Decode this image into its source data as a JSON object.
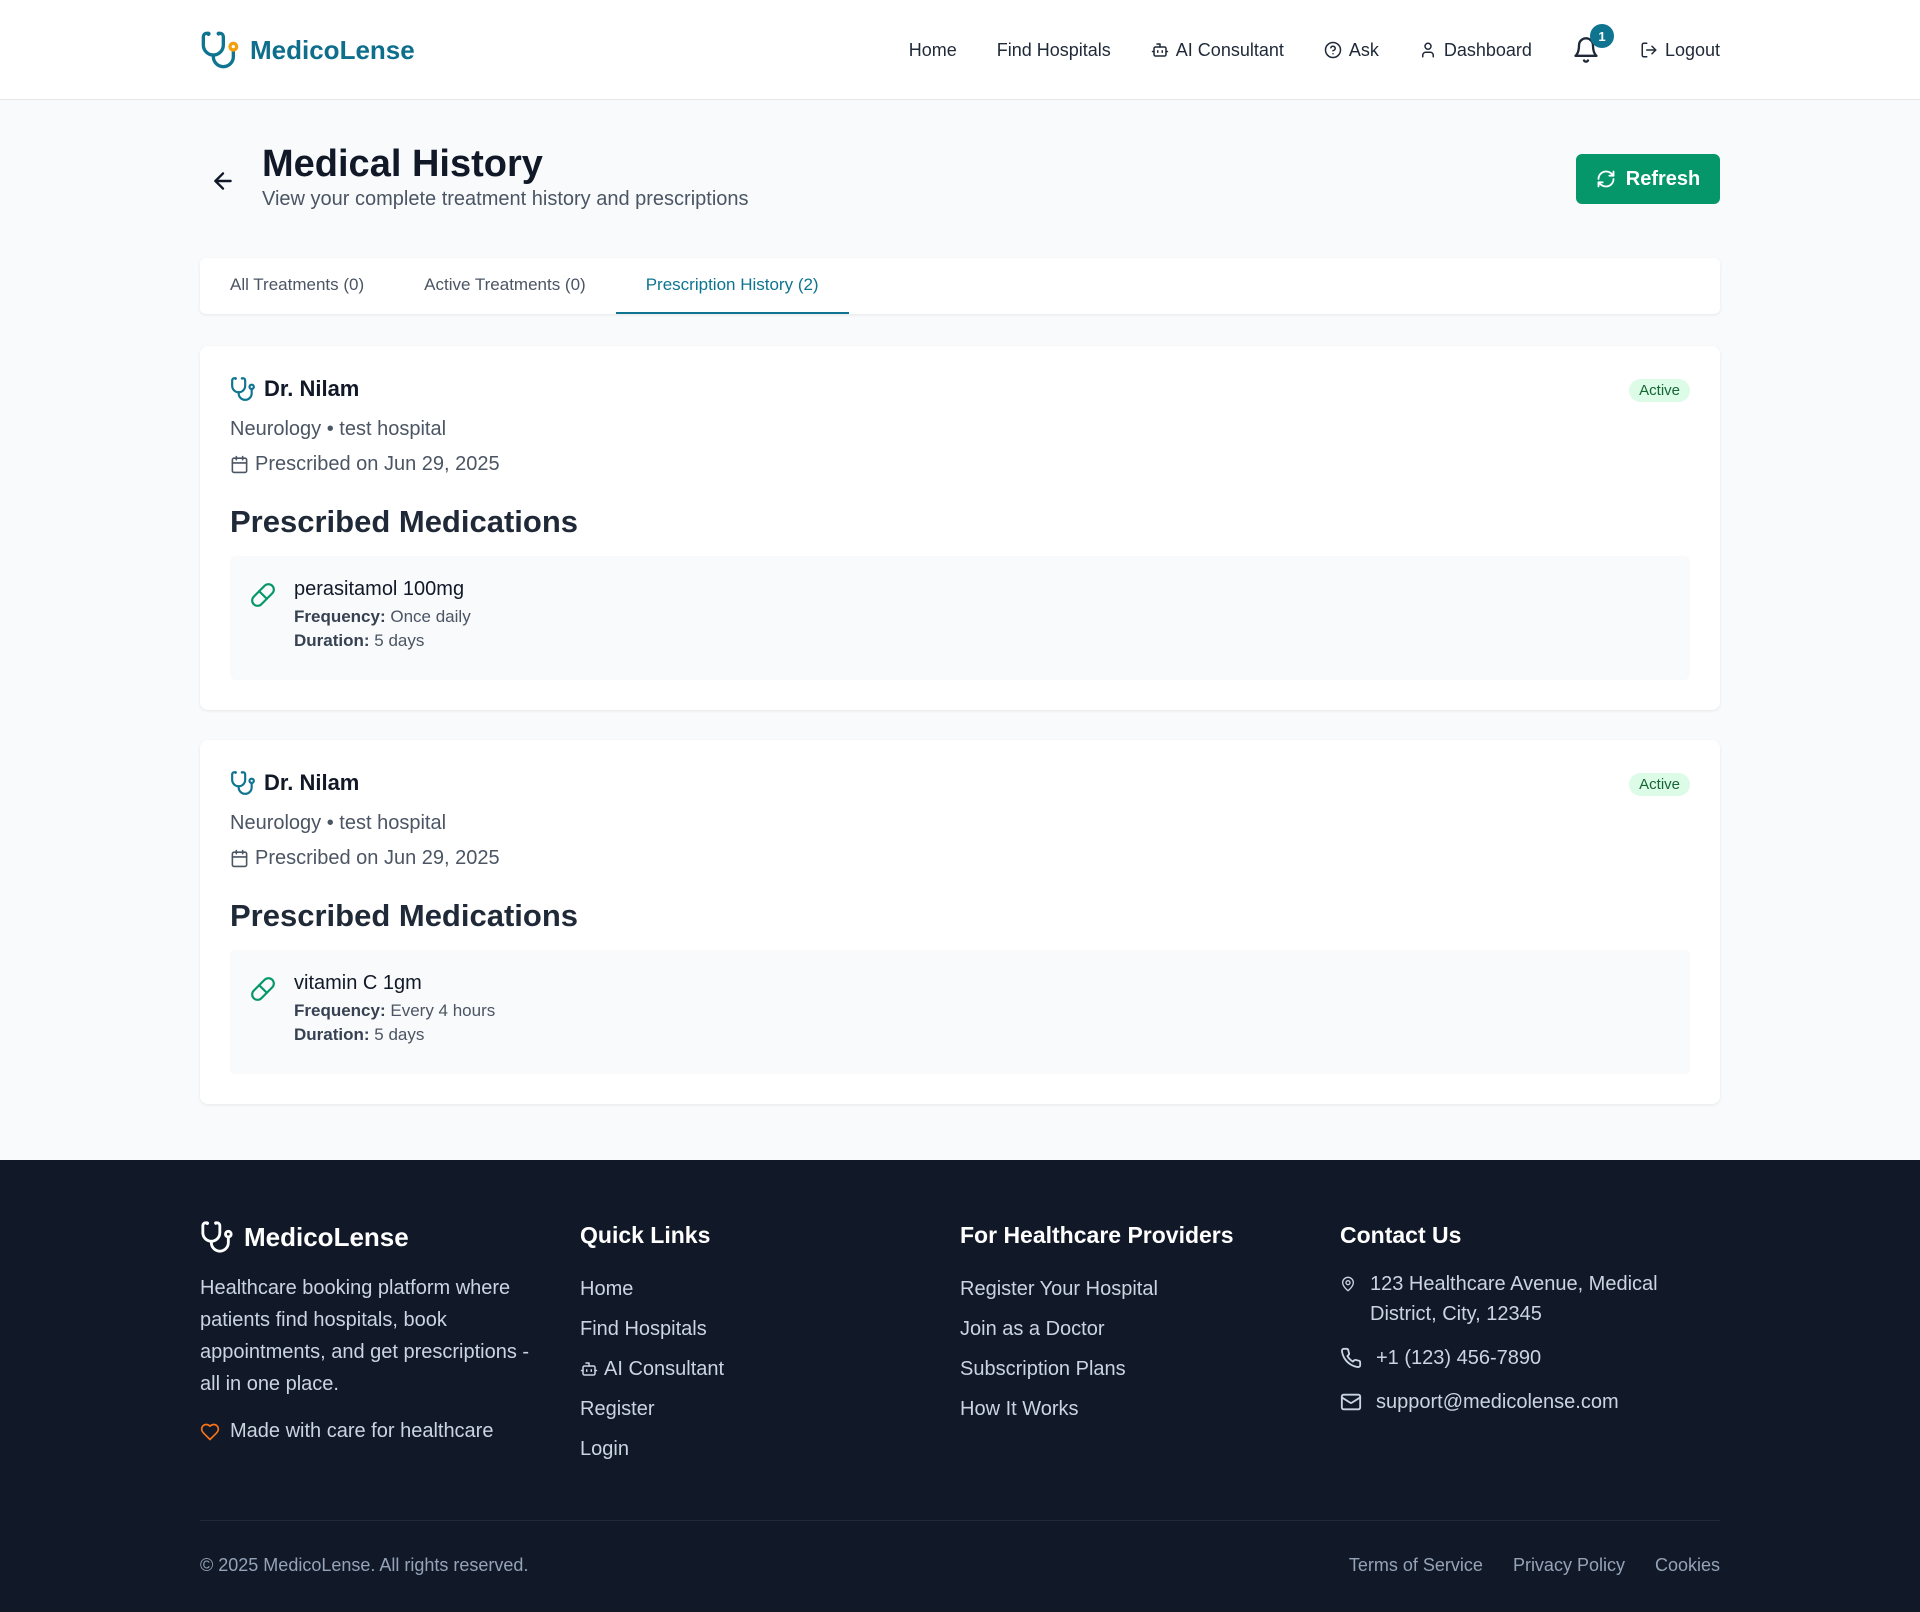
{
  "header": {
    "brand": "MedicoLense",
    "nav": {
      "home": "Home",
      "find_hospitals": "Find Hospitals",
      "ai_consultant": "AI Consultant",
      "ask": "Ask",
      "dashboard": "Dashboard",
      "notification_count": "1",
      "logout": "Logout"
    }
  },
  "page": {
    "title": "Medical History",
    "subtitle": "View your complete treatment history and prescriptions",
    "refresh_label": "Refresh"
  },
  "tabs": [
    {
      "label": "All Treatments (0)",
      "active": false
    },
    {
      "label": "Active Treatments (0)",
      "active": false
    },
    {
      "label": "Prescription History (2)",
      "active": true
    }
  ],
  "prescriptions": [
    {
      "doctor": "Dr. Nilam",
      "status": "Active",
      "department": "Neurology • test hospital",
      "date": "Prescribed on Jun 29, 2025",
      "section_title": "Prescribed Medications",
      "medication": {
        "name": "perasitamol 100mg",
        "frequency_label": "Frequency:",
        "frequency": "Once daily",
        "duration_label": "Duration:",
        "duration": "5 days"
      }
    },
    {
      "doctor": "Dr. Nilam",
      "status": "Active",
      "department": "Neurology • test hospital",
      "date": "Prescribed on Jun 29, 2025",
      "section_title": "Prescribed Medications",
      "medication": {
        "name": "vitamin C 1gm",
        "frequency_label": "Frequency:",
        "frequency": "Every 4 hours",
        "duration_label": "Duration:",
        "duration": "5 days"
      }
    }
  ],
  "footer": {
    "brand": "MedicoLense",
    "description": "Healthcare booking platform where patients find hospitals, book appointments, and get prescriptions - all in one place.",
    "tagline": "Made with care for healthcare",
    "quick_links_title": "Quick Links",
    "quick_links": [
      "Home",
      "Find Hospitals",
      "AI Consultant",
      "Register",
      "Login"
    ],
    "providers_title": "For Healthcare Providers",
    "providers_links": [
      "Register Your Hospital",
      "Join as a Doctor",
      "Subscription Plans",
      "How It Works"
    ],
    "contact_title": "Contact Us",
    "address": "123 Healthcare Avenue, Medical District, City, 12345",
    "phone": "+1 (123) 456-7890",
    "email": "support@medicolense.com",
    "copyright": "© 2025 MedicoLense. All rights reserved.",
    "legal": [
      "Terms of Service",
      "Privacy Policy",
      "Cookies"
    ]
  },
  "colors": {
    "brand": "#0e6e8c",
    "accent_green": "#059669",
    "active_tab": "#0e7490",
    "footer_bg": "#111827",
    "badge_bg": "#dcfce7"
  },
  "icons": [
    "stethoscope-icon",
    "bot-icon",
    "help-circle-icon",
    "user-icon",
    "bell-icon",
    "logout-icon",
    "arrow-left-icon",
    "refresh-icon",
    "calendar-icon",
    "pill-icon",
    "heart-icon",
    "map-pin-icon",
    "phone-icon",
    "mail-icon"
  ]
}
